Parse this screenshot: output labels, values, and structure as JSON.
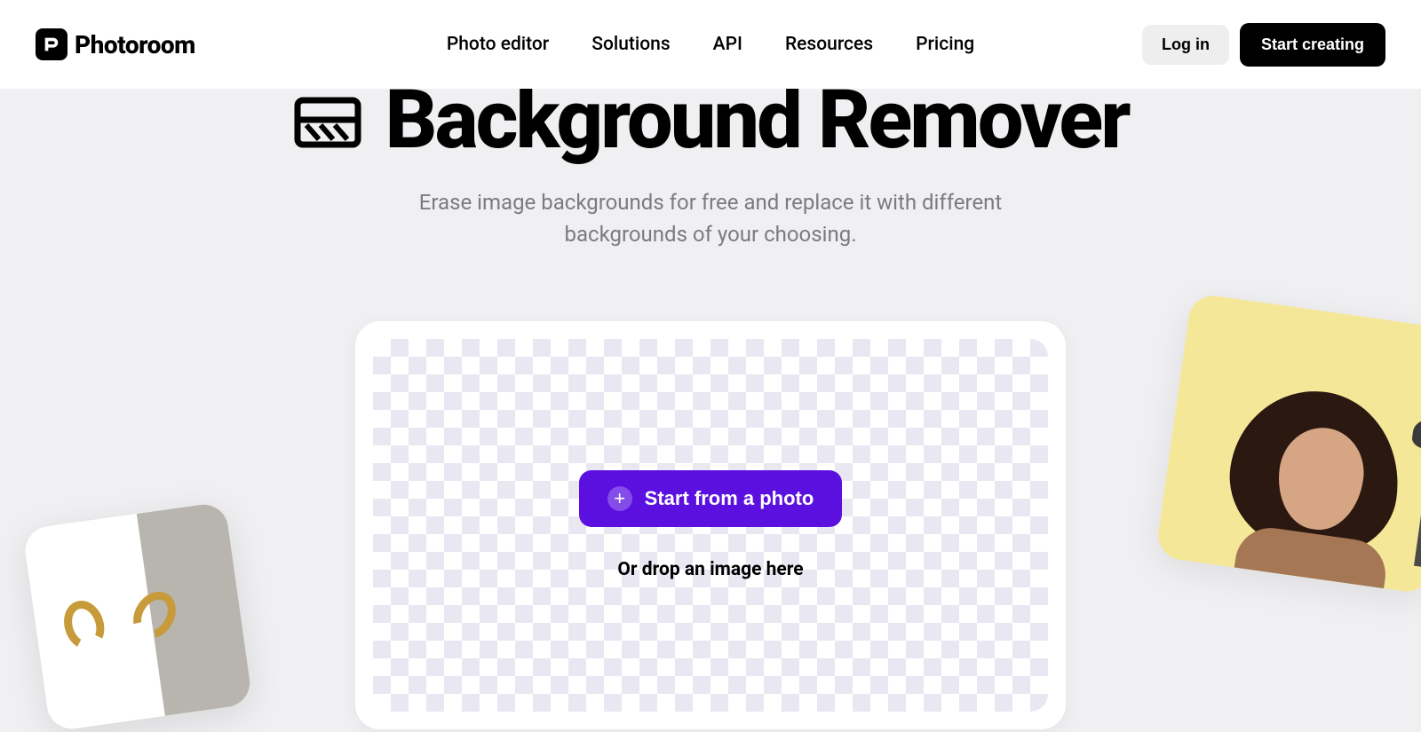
{
  "brand": {
    "name": "Photoroom",
    "logo_letter": "P"
  },
  "nav": {
    "items": [
      {
        "label": "Photo editor"
      },
      {
        "label": "Solutions"
      },
      {
        "label": "API"
      },
      {
        "label": "Resources"
      },
      {
        "label": "Pricing"
      }
    ]
  },
  "header_actions": {
    "login": "Log in",
    "start_creating": "Start creating"
  },
  "hero": {
    "title": "Background Remover",
    "subtitle": "Erase image backgrounds for free and replace it with different backgrounds of your choosing."
  },
  "upload": {
    "button_label": "Start from a photo",
    "drop_text": "Or drop an image here"
  },
  "colors": {
    "accent": "#5b10e0",
    "background": "#f0f0f2"
  }
}
